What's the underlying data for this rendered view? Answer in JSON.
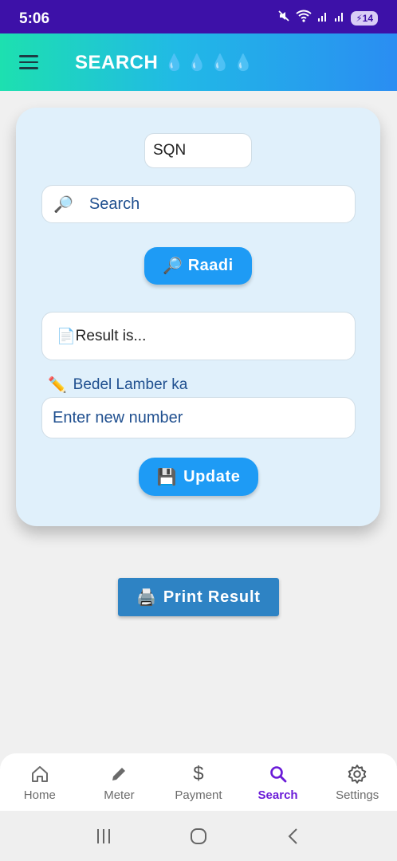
{
  "status_bar": {
    "time": "5:06",
    "battery": "14",
    "icons": [
      "mute-icon",
      "wifi-icon",
      "signal-icon",
      "signal-icon"
    ]
  },
  "app_bar": {
    "title": "SEARCH",
    "decoration": "💧💧💧💧"
  },
  "card": {
    "prefix_value": "SQN",
    "search": {
      "icon": "🔎",
      "placeholder": "Search"
    },
    "search_button": {
      "icon": "🔎",
      "label": "Raadi"
    },
    "result": {
      "icon": "📄",
      "text": "Result is..."
    },
    "update_section": {
      "label_icon": "✏️",
      "label": "Bedel Lamber ka",
      "placeholder": "Enter new number"
    },
    "update_button": {
      "icon": "💾",
      "label": "Update"
    }
  },
  "print_button": {
    "icon": "🖨️",
    "label": "Print Result"
  },
  "bottom_nav": {
    "items": [
      {
        "label": "Home",
        "icon": "home-icon"
      },
      {
        "label": "Meter",
        "icon": "pencil-icon"
      },
      {
        "label": "Payment",
        "icon": "dollar-icon"
      },
      {
        "label": "Search",
        "icon": "search-icon"
      },
      {
        "label": "Settings",
        "icon": "gear-icon"
      }
    ],
    "active": "Search"
  },
  "colors": {
    "status_bar": "#3d11a8",
    "accent_button": "#1e9bf5",
    "print_button": "#2e83c4",
    "nav_active": "#6a1bd8",
    "text_blue": "#1f4f8f"
  }
}
